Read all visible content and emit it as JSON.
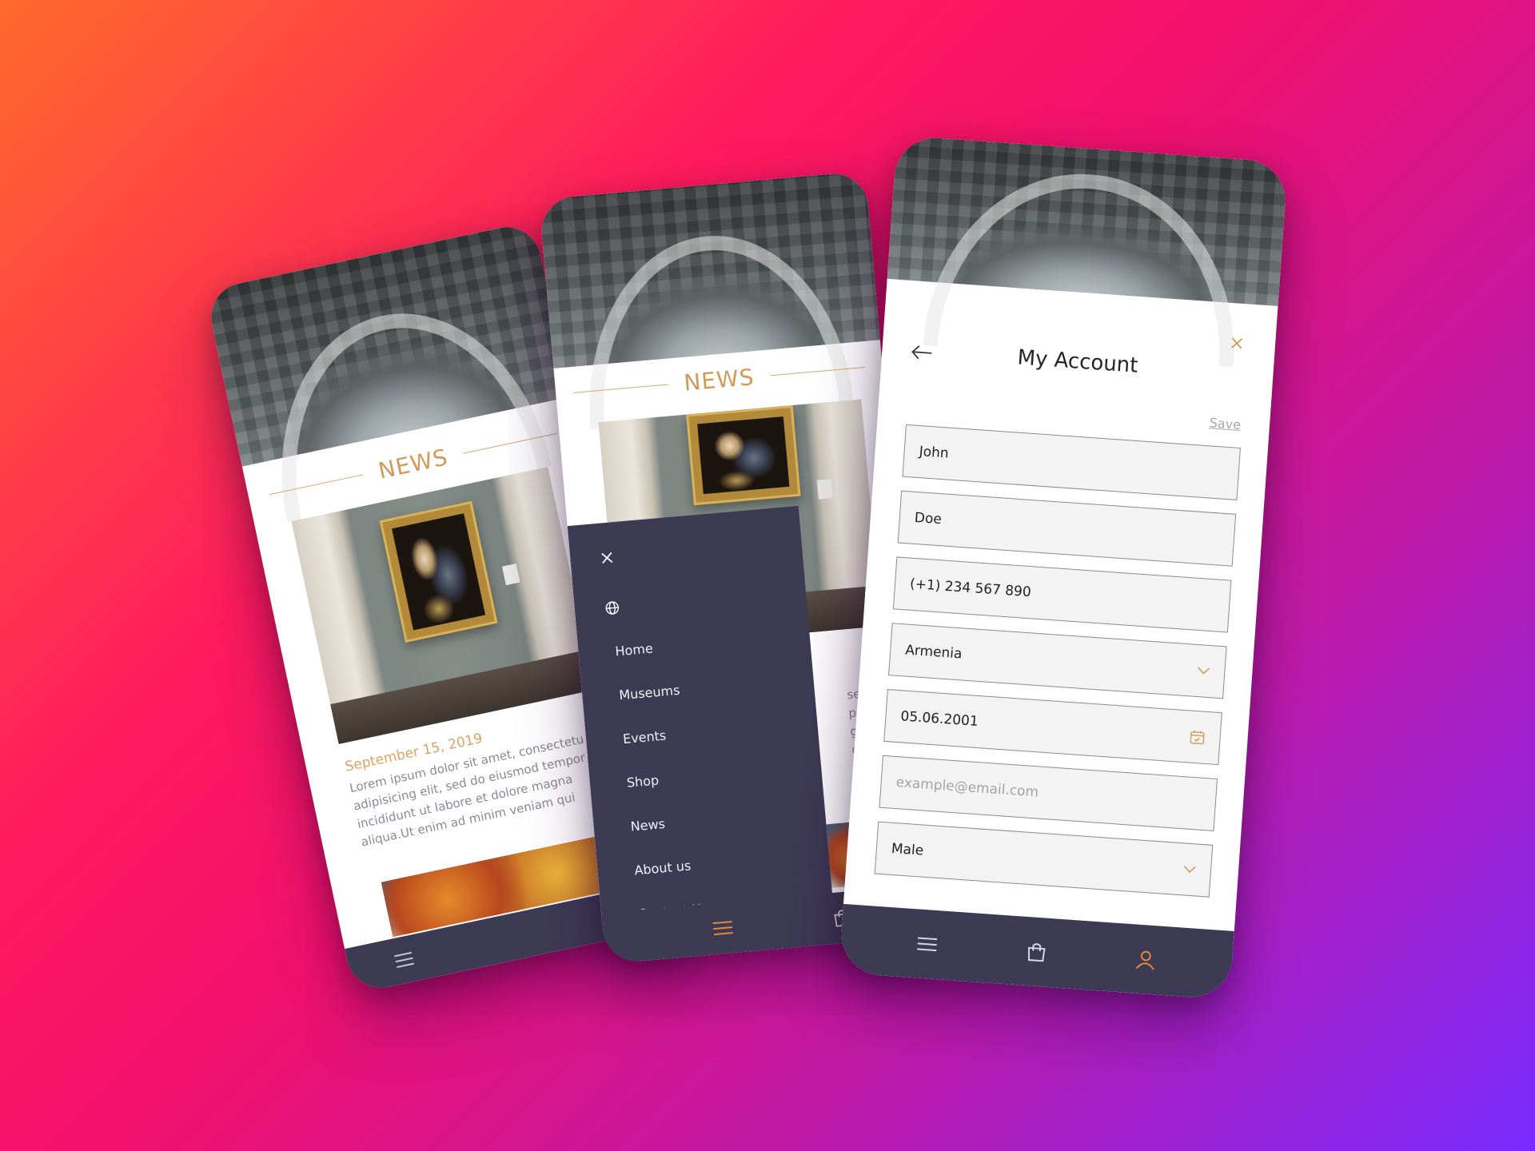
{
  "theme": {
    "accent": "#d19a5a",
    "navy": "#3d3a54",
    "field_bg": "#f3f3f3"
  },
  "news_screen": {
    "heading": "NEWS",
    "article": {
      "date": "September 15, 2019",
      "text_lines": [
        "Lorem ipsum dolor sit amet, consectetu",
        "adipisicing elit, sed do eiusmod tempor",
        "incididunt ut labore et dolore magna",
        "aliqua.Ut enim ad minim veniam qui"
      ]
    },
    "navbar": {
      "menu_icon": "menu-icon"
    }
  },
  "menu_screen": {
    "heading": "NEWS",
    "peek_text_lines": [
      "sectetu",
      "pr",
      "gna",
      "qui"
    ],
    "menu": {
      "close_icon": "close-icon",
      "globe_icon": "globe-icon",
      "items": [
        "Home",
        "Museums",
        "Events",
        "Shop",
        "News",
        "About us",
        "Contact Us"
      ]
    },
    "navbar": {
      "menu_icon": "menu-icon",
      "bag_icon": "shopping-bag-icon"
    }
  },
  "account_screen": {
    "title": "My Account",
    "save_label": "Save",
    "first_name": "John",
    "last_name": "Doe",
    "phone": "(+1) 234 567 890",
    "country": "Armenia",
    "birth_date": "05.06.2001",
    "email_placeholder": "example@email.com",
    "gender": "Male",
    "navbar": {
      "menu_icon": "menu-icon",
      "bag_icon": "shopping-bag-icon",
      "user_icon": "user-icon"
    }
  }
}
